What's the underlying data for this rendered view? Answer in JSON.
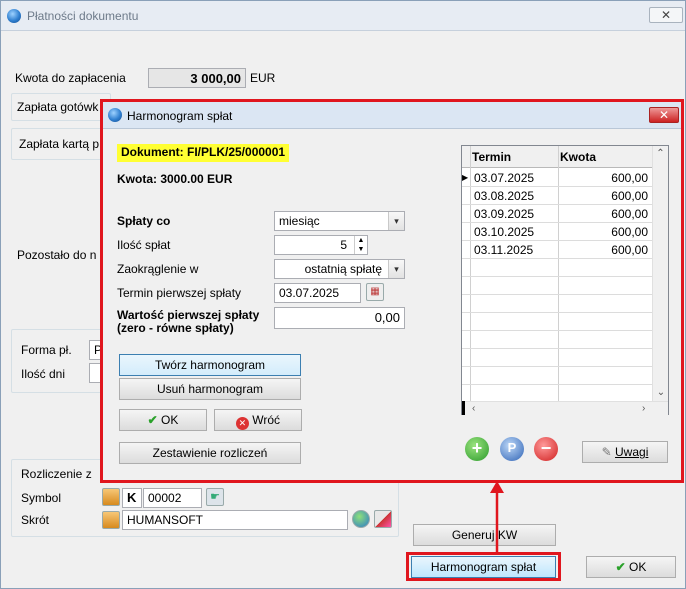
{
  "outer": {
    "title": "Płatności dokumentu",
    "close_glyph": "✕",
    "kwota_label": "Kwota do zapłacenia",
    "kwota_value": "3 000,00",
    "kwota_currency": "EUR",
    "zaplata_gotowka_label": "Zapłata gotówk",
    "zaplata_karta_label": "Zapłata kartą p",
    "pozostalo_label": "Pozostało do n",
    "forma_label": "Forma pł.",
    "forma_value": "P",
    "ilosc_dni_label": "Ilość dni",
    "rozliczenie_label": "Rozliczenie z",
    "symbol_label": "Symbol",
    "symbol_k": "K",
    "symbol_value": "00002",
    "skrot_label": "Skrót",
    "skrot_value": "HUMANSOFT",
    "generuj_kw_label": "Generuj KW",
    "harmonogram_button_label": "Harmonogram spłat",
    "ok_label": "OK"
  },
  "dialog": {
    "title": "Harmonogram spłat",
    "close_glyph": "✕",
    "dokument": "Dokument: FI/PLK/25/000001",
    "kwota": "Kwota: 3000.00 EUR",
    "splaty_co_label": "Spłaty co",
    "splaty_co_value": "miesiąc",
    "ilosc_splat_label": "Ilość spłat",
    "ilosc_splat_value": "5",
    "zaokraglenie_label": "Zaokrąglenie w",
    "zaokraglenie_value": "ostatnią spłatę",
    "termin_label": "Termin pierwszej spłaty",
    "termin_value": "03.07.2025",
    "wartosc_label_1": "Wartość pierwszej spłaty",
    "wartosc_label_2": "(zero - równe spłaty)",
    "wartosc_value": "0,00",
    "tworz_label": "Twórz harmonogram",
    "usun_label": "Usuń harmonogram",
    "ok_label": "OK",
    "wroc_label": "Wróć",
    "zestawienie_label": "Zestawienie rozliczeń",
    "uwagi_label": "Uwagi",
    "grid": {
      "columns": [
        "Termin",
        "Kwota"
      ],
      "rows": [
        [
          "03.07.2025",
          "600,00"
        ],
        [
          "03.08.2025",
          "600,00"
        ],
        [
          "03.09.2025",
          "600,00"
        ],
        [
          "03.10.2025",
          "600,00"
        ],
        [
          "03.11.2025",
          "600,00"
        ]
      ],
      "current_row_marker": "▶"
    }
  },
  "colors": {
    "highlight_red": "#e0161e",
    "dokument_highlight": "#ffff33"
  }
}
